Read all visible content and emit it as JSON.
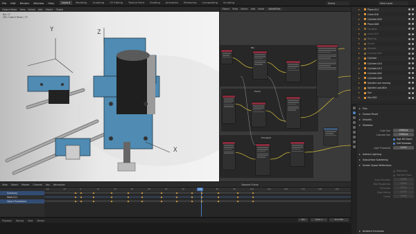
{
  "topbar": {
    "menus": [
      "File",
      "Edit",
      "Render",
      "Window",
      "Help"
    ],
    "workspaces": [
      "Layout",
      "Modeling",
      "Sculpting",
      "UV Editing",
      "Texture Paint",
      "Shading",
      "Animation",
      "Rendering",
      "Compositing",
      "Scripting"
    ],
    "active_workspace": "Layout",
    "scene": "Scene",
    "view_layer": "View Layer"
  },
  "viewport_header": {
    "mode": "Object Mode",
    "items": [
      "View",
      "Select",
      "Add",
      "Object"
    ],
    "orientation": "Global"
  },
  "viewport_info": {
    "line1": "fps: 17",
    "line2": "(95) Cube.0 Faces | 75"
  },
  "axis_labels": {
    "y": "Y",
    "z": "Z",
    "x": "X"
  },
  "node_editor_header": {
    "items": [
      "Object",
      "View",
      "Select",
      "Add",
      "Node"
    ],
    "use_nodes": "Use Nodes",
    "node_tree": "NodeTree"
  },
  "node_titles": [
    "Mix",
    "Frame",
    "Principled"
  ],
  "outliner": {
    "rows": [
      {
        "name": "Plane.011",
        "dim": false
      },
      {
        "name": "Cube.016",
        "dim": false
      },
      {
        "name": "Cylinder.003",
        "dim": false
      },
      {
        "name": "Plane.008",
        "dim": false
      },
      {
        "name": "Housing",
        "dim": true
      },
      {
        "name": "Cube.019",
        "dim": true
      },
      {
        "name": "Bearing",
        "dim": true
      },
      {
        "name": "Screw",
        "dim": true
      },
      {
        "name": "Bracket",
        "dim": true
      },
      {
        "name": "Cylinder.002",
        "dim": true
      },
      {
        "name": "Cylinder",
        "dim": false
      },
      {
        "name": "Cylinder.010",
        "dim": false
      },
      {
        "name": "Cylinder.013",
        "dim": false
      },
      {
        "name": "Cylinder.004",
        "dim": false
      },
      {
        "name": "Cylinder.006",
        "dim": false
      },
      {
        "name": "Spindle Low moving",
        "dim": false
      },
      {
        "name": "Spindle Low.0Kin",
        "dim": false
      },
      {
        "name": "Sun",
        "dim": false
      },
      {
        "name": "Sun.002",
        "dim": false
      }
    ]
  },
  "properties": {
    "sections": {
      "film": "Film",
      "grease_pencil": "Grease Pencil",
      "simplify": "Simplify",
      "shadows": "Shadows",
      "indirect": "Indirect Lighting",
      "subsurface": "Subsurface Scattering",
      "ssr": "Screen Space Reflections",
      "ao": "Ambient Occlusion"
    },
    "cube_size_label": "Cube Size",
    "cube_size": "2048 px",
    "cascade_size_label": "Cascade Size",
    "cascade_size": "2048 px",
    "high_bit_depth": "High Bit Depth",
    "soft_shadows": "Soft Shadows",
    "light_threshold_label": "Light Threshold",
    "light_threshold": "0.010",
    "refraction": "Refraction",
    "half_res_trace": "Half Res Trace",
    "trace_precision_label": "Trace Precision",
    "trace_precision": "0.250",
    "max_roughness_label": "Max Roughness",
    "max_roughness": "0.500",
    "thickness_label": "Thickness",
    "thickness": "0.2 m",
    "edge_fading_label": "Edge Fading",
    "edge_fading": "0.075",
    "clamp_label": "Clamp",
    "clamp": "0.000"
  },
  "timeline": {
    "header": [
      "View",
      "Select",
      "Marker",
      "Channel",
      "Key",
      "Normalize"
    ],
    "interp": "Nearest Frame",
    "rows": [
      "Summary",
      "Mesh.011",
      "Object Transforms"
    ],
    "ruler": [
      "-20",
      "-10",
      "0",
      "10",
      "20",
      "30",
      "40",
      "50",
      "60",
      "70",
      "80",
      "90",
      "100",
      "110",
      "120",
      "130",
      "140",
      "150"
    ],
    "current_frame": "101"
  },
  "statusbar": {
    "items": [
      "Playback",
      "Keying",
      "View",
      "Marker"
    ],
    "frame": "101",
    "start_label": "Start",
    "start": "1",
    "end_label": "End",
    "end": "250"
  }
}
